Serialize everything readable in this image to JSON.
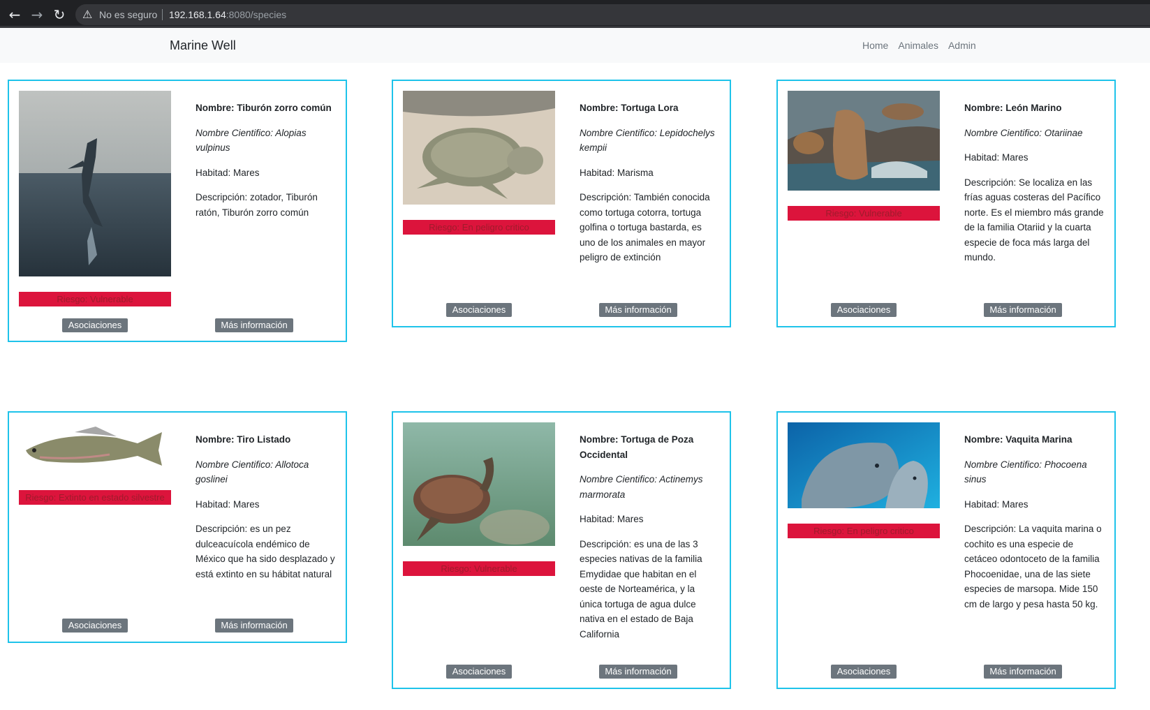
{
  "browser": {
    "insecure_label": "No es seguro",
    "url_host": "192.168.1.64",
    "url_rest": ":8080/species"
  },
  "navbar": {
    "brand": "Marine Well",
    "links": [
      "Home",
      "Animales",
      "Admin"
    ]
  },
  "buttons": {
    "associations": "Asociaciones",
    "more_info": "Más información"
  },
  "cards": [
    {
      "name": "Nombre: Tiburón zorro común",
      "scientific": "Nombre Cientifico: Alopias vulpinus",
      "habitat": "Habitad: Mares",
      "description": "Descripción: zotador, Tiburón ratón, Tiburón zorro común",
      "risk": "Riesgo: Vulnerable"
    },
    {
      "name": "Nombre: Tortuga Lora",
      "scientific": "Nombre Cientifico: Lepidochelys kempii",
      "habitat": "Habitad: Marisma",
      "description": "Descripción: También conocida como tortuga cotorra, tortuga golfina o tortuga bastarda, es uno de los animales en mayor peligro de extinción",
      "risk": "Riesgo: En peligro critico"
    },
    {
      "name": "Nombre: León Marino",
      "scientific": "Nombre Cientifico: Otariinae",
      "habitat": "Habitad: Mares",
      "description": "Descripción: Se localiza en las frías aguas costeras del Pacífico norte. Es el miembro más grande de la familia Otariid y la cuarta especie de foca más larga del mundo.",
      "risk": "Riesgo: Vulnerable"
    },
    {
      "name": "Nombre: Tiro Listado",
      "scientific": "Nombre Cientifico: Allotoca goslinei",
      "habitat": "Habitad: Mares",
      "description": "Descripción: es un pez dulceacuícola endémico de México que ha sido desplazado y está extinto en su hábitat natural",
      "risk": "Riesgo: Extinto en estado silvestre"
    },
    {
      "name": "Nombre: Tortuga de Poza Occidental",
      "scientific": "Nombre Cientifico: Actinemys marmorata",
      "habitat": "Habitad: Mares",
      "description": "Descripción: es una de las 3 especies nativas de la familia Emydidae que habitan en el oeste de Norteamérica, y la única tortuga de agua dulce nativa en el estado de Baja California",
      "risk": "Riesgo: Vulnerable"
    },
    {
      "name": "Nombre: Vaquita Marina",
      "scientific": "Nombre Cientifico: Phocoena sinus",
      "habitat": "Habitad: Mares",
      "description": "Descripción: La vaquita marina o cochito es una especie de cetáceo odontoceto de la familia Phocoenidae, una de las siete especies de marsopa. Mide 150 cm de largo y pesa hasta 50 kg.",
      "risk": "Riesgo: En peligro critico"
    }
  ]
}
